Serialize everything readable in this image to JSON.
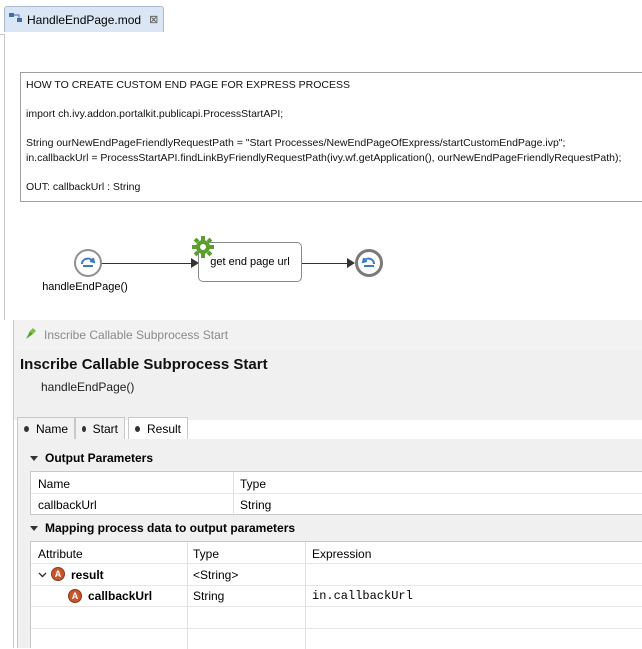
{
  "editor": {
    "tab_title": "HandleEndPage.mod",
    "tab_icon": "process-model-icon",
    "close_glyph": "⊠"
  },
  "note": {
    "lines": [
      "HOW TO CREATE CUSTOM END PAGE FOR EXPRESS PROCESS",
      "",
      "import ch.ivy.addon.portalkit.publicapi.ProcessStartAPI;",
      "",
      "String ourNewEndPageFriendlyRequestPath = \"Start Processes/NewEndPageOfExpress/startCustomEndPage.ivp\";",
      "in.callbackUrl = ProcessStartAPI.findLinkByFriendlyRequestPath(ivy.wf.getApplication(), ourNewEndPageFriendlyRequestPath);",
      "",
      "OUT: callbackUrl : String"
    ]
  },
  "process": {
    "start_label": "handleEndPage()",
    "task_label": "get end page url"
  },
  "panel": {
    "view_title": "Inscribe Callable Subprocess Start",
    "header_title": "Inscribe Callable Subprocess Start",
    "header_subtitle": "handleEndPage()",
    "tabs": [
      {
        "label": "Name"
      },
      {
        "label": "Start"
      },
      {
        "label": "Result"
      }
    ],
    "active_tab": "Result"
  },
  "output_parameters": {
    "section_title": "Output Parameters",
    "columns": [
      "Name",
      "Type"
    ],
    "rows": [
      {
        "name": "callbackUrl",
        "type": "String"
      }
    ]
  },
  "mapping": {
    "section_title": "Mapping process data to output parameters",
    "columns": [
      "Attribute",
      "Type",
      "Expression"
    ],
    "rows": [
      {
        "attribute": "result",
        "type": "<String>",
        "expression": ""
      },
      {
        "attribute": "callbackUrl",
        "type": "String",
        "expression": "in.callbackUrl"
      }
    ]
  },
  "colors": {
    "tab_active": "#dae6f3",
    "attribute_icon": "#c8562b",
    "gear_green": "#5a9e2f"
  }
}
